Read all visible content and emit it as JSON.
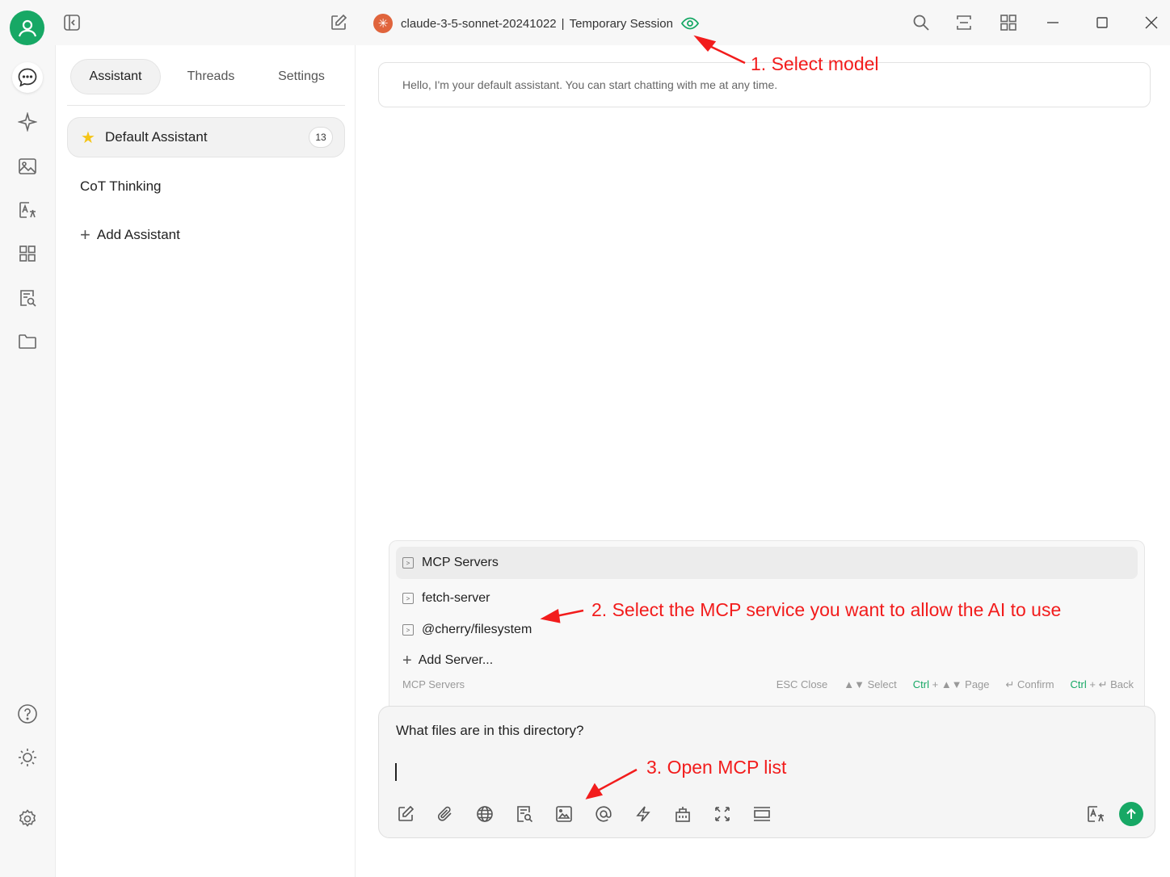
{
  "window": {
    "model_name": "claude-3-5-sonnet-20241022",
    "separator": "|",
    "session_label": "Temporary Session"
  },
  "sidebar": {
    "tabs": [
      {
        "label": "Assistant",
        "active": true
      },
      {
        "label": "Threads",
        "active": false
      },
      {
        "label": "Settings",
        "active": false
      }
    ],
    "assistants": [
      {
        "label": "Default Assistant",
        "count": "13",
        "selected": true
      },
      {
        "label": "CoT Thinking",
        "selected": false
      }
    ],
    "add_assistant_label": "Add Assistant"
  },
  "chat": {
    "welcome_message": "Hello, I'm your default assistant. You can start chatting with me at any time."
  },
  "mcp_panel": {
    "header": "MCP Servers",
    "servers": [
      "fetch-server",
      "@cherry/filesystem"
    ],
    "add_server_label": "Add Server...",
    "footer_label": "MCP Servers",
    "hints": {
      "esc": "ESC Close",
      "select": "▲▼ Select",
      "page_key": "Ctrl",
      "page": "+ ▲▼ Page",
      "confirm": "↵ Confirm",
      "back_key": "Ctrl",
      "back": "+ ↵ Back"
    }
  },
  "input": {
    "text": "What files are in this directory?"
  },
  "annotations": {
    "step1": "1. Select model",
    "step2": "2. Select the MCP service you want to allow the AI to use",
    "step3": "3. Open MCP list"
  },
  "icons": {
    "topbar": [
      "user-avatar-icon",
      "sidebar-toggle-icon",
      "edit-icon",
      "eye-icon",
      "search-icon",
      "expand-icon",
      "grid-icon",
      "minimize-icon",
      "maximize-icon",
      "close-icon"
    ],
    "rail": [
      "chat-icon",
      "sparkle-icon",
      "image-icon",
      "translate-icon",
      "apps-icon",
      "document-search-icon",
      "folder-icon",
      "help-icon",
      "theme-icon",
      "settings-icon"
    ],
    "toolbar": [
      "new-topic-icon",
      "attachment-icon",
      "web-search-icon",
      "knowledge-icon",
      "image-gen-icon",
      "mention-icon",
      "quick-phrase-icon",
      "mcp-icon",
      "fullscreen-icon",
      "clear-icon",
      "translate-icon",
      "send-icon"
    ]
  },
  "colors": {
    "brand_green": "#17a865",
    "annotation_red": "#f21c1c",
    "claude_orange": "#e0643c",
    "star_yellow": "#f5c518"
  }
}
